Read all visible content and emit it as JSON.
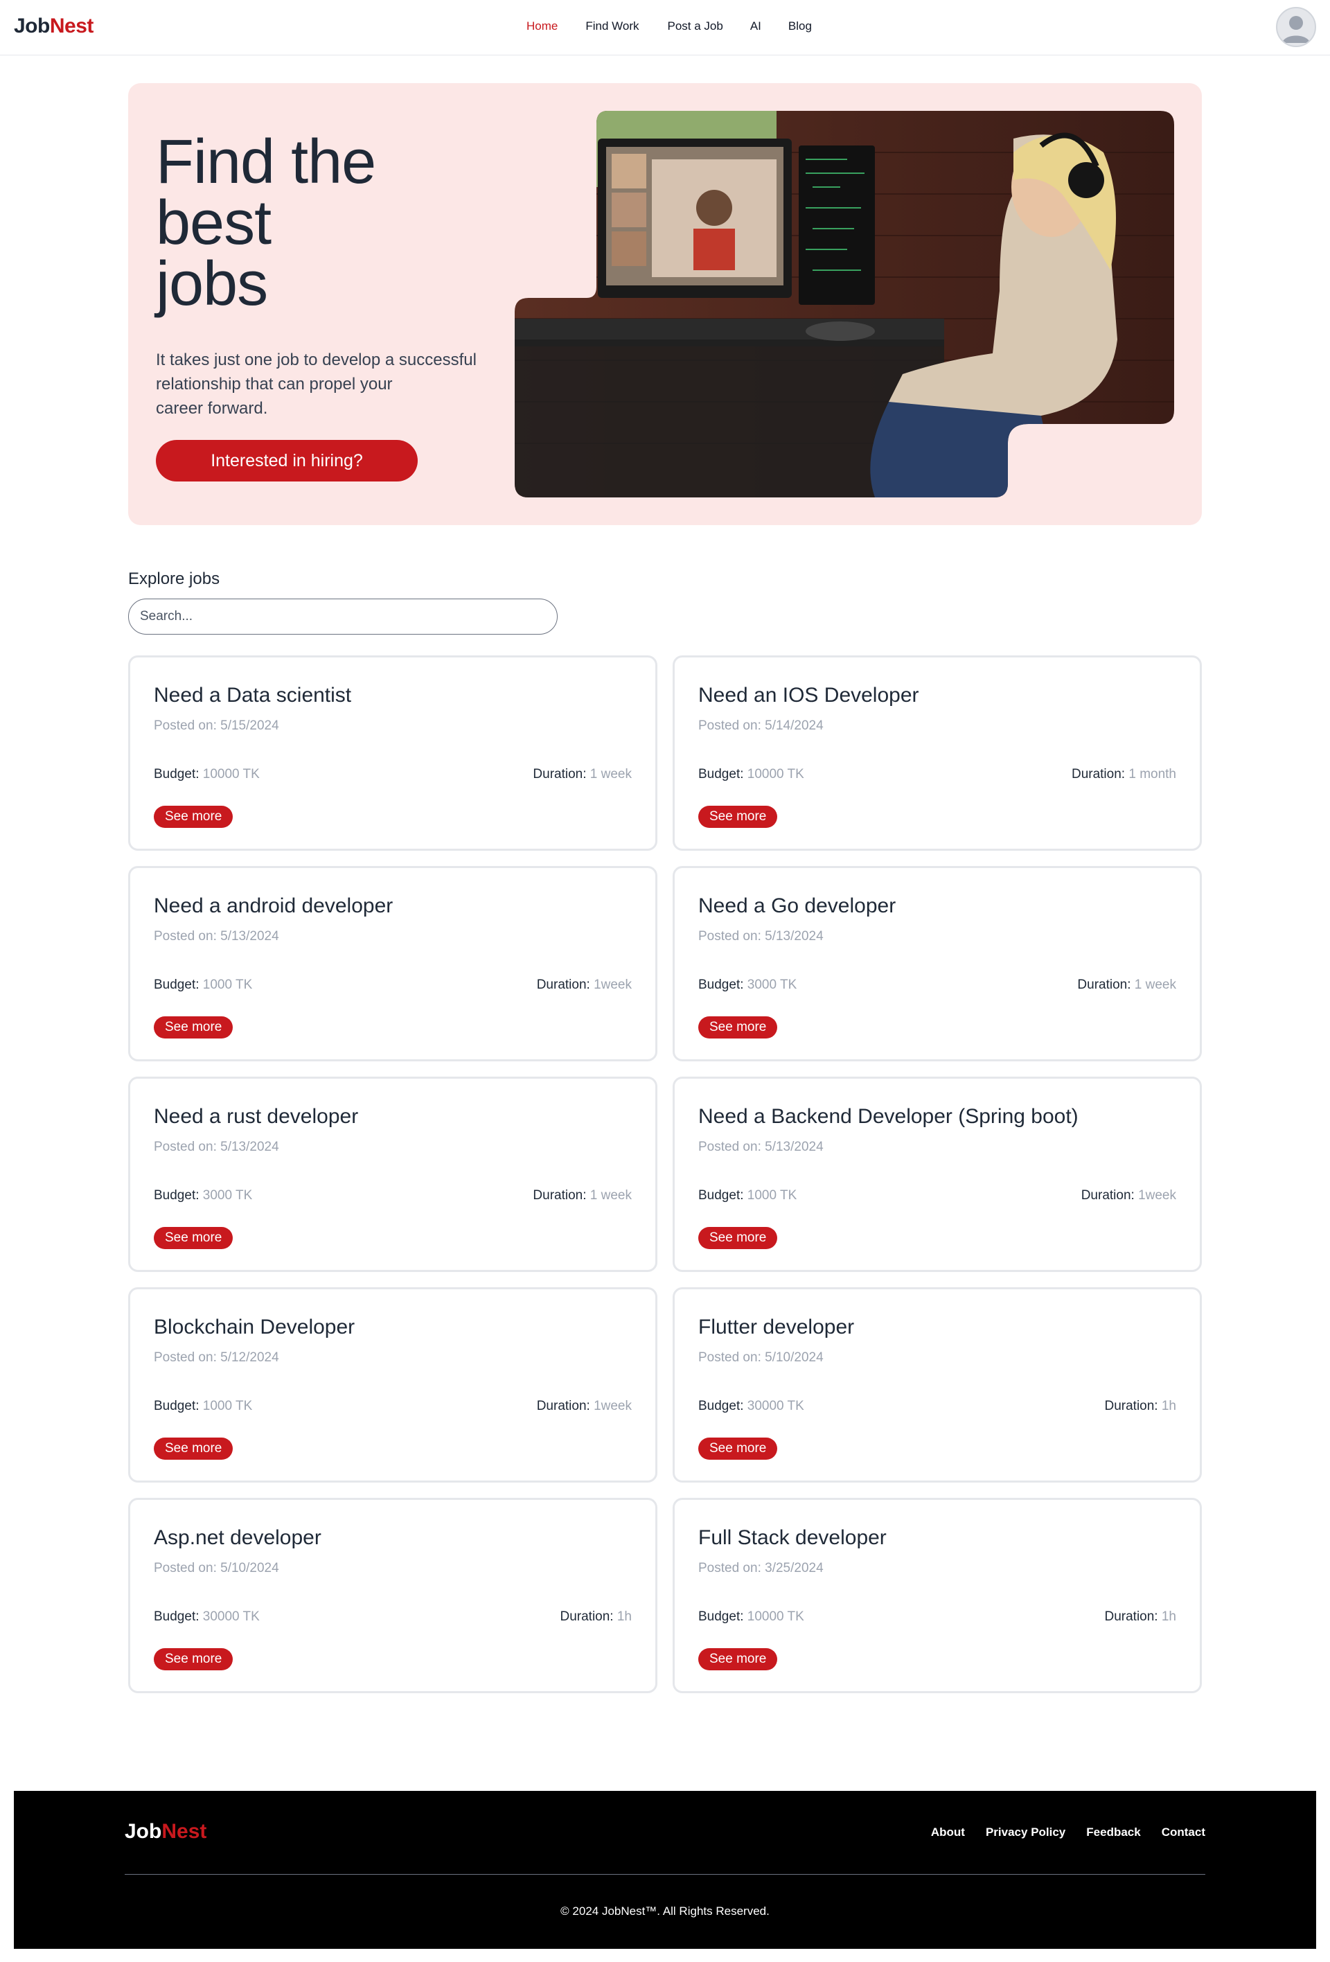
{
  "nav": {
    "logo_a": "Job",
    "logo_b": "Nest",
    "links": [
      "Home",
      "Find Work",
      "Post a Job",
      "AI",
      "Blog"
    ],
    "active": "Home"
  },
  "hero": {
    "title_l1": "Find the",
    "title_l2": "best",
    "title_l3": "jobs",
    "subtitle_l1": "It takes just one job to develop a successful",
    "subtitle_l2": "relationship that can propel your",
    "subtitle_l3": "career forward.",
    "cta": "Interested in hiring?"
  },
  "explore": {
    "title": "Explore jobs",
    "search_placeholder": "Search..."
  },
  "jobs": [
    {
      "title": "Need a Data scientist",
      "posted": "5/15/2024",
      "budget": "10000 TK",
      "duration": "1 week"
    },
    {
      "title": "Need an IOS Developer",
      "posted": "5/14/2024",
      "budget": "10000 TK",
      "duration": "1 month"
    },
    {
      "title": "Need a android developer",
      "posted": "5/13/2024",
      "budget": "1000 TK",
      "duration": "1week"
    },
    {
      "title": "Need a Go developer",
      "posted": "5/13/2024",
      "budget": "3000 TK",
      "duration": "1 week"
    },
    {
      "title": "Need a rust developer",
      "posted": "5/13/2024",
      "budget": "3000 TK",
      "duration": "1 week"
    },
    {
      "title": "Need a Backend Developer (Spring boot)",
      "posted": "5/13/2024",
      "budget": "1000 TK",
      "duration": "1week"
    },
    {
      "title": "Blockchain Developer",
      "posted": "5/12/2024",
      "budget": "1000 TK",
      "duration": "1week"
    },
    {
      "title": "Flutter developer",
      "posted": "5/10/2024",
      "budget": "30000 TK",
      "duration": "1h"
    },
    {
      "title": "Asp.net developer",
      "posted": "5/10/2024",
      "budget": "30000 TK",
      "duration": "1h"
    },
    {
      "title": "Full Stack developer",
      "posted": "3/25/2024",
      "budget": "10000 TK",
      "duration": "1h"
    }
  ],
  "labels": {
    "posted_on": "Posted on: ",
    "budget": "Budget: ",
    "duration": "Duration: ",
    "see_more": "See more"
  },
  "footer": {
    "logo_a": "Job",
    "logo_b": "Nest",
    "links": [
      "About",
      "Privacy Policy",
      "Feedback",
      "Contact"
    ],
    "copyright": "© 2024 JobNest™. All Rights Reserved."
  },
  "colors": {
    "brand": "#c8191e",
    "hero_bg": "#fce7e6",
    "footer_bg": "#000000"
  },
  "icons": {
    "avatar": "user-avatar-icon"
  }
}
